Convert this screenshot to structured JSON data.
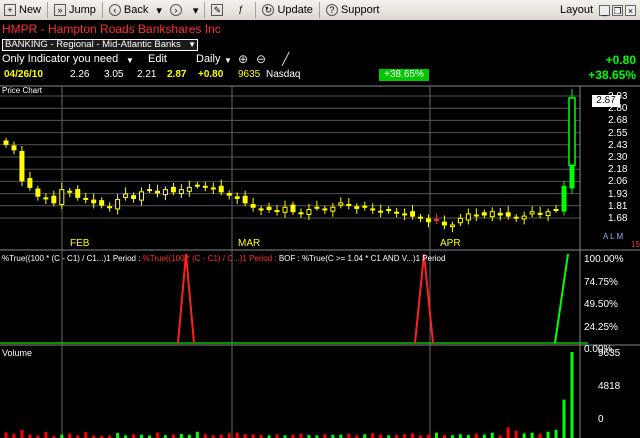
{
  "toolbar": {
    "new_label": "New",
    "jump_label": "Jump",
    "back_label": "Back",
    "update_label": "Update",
    "support_label": "Support",
    "layout_label": "Layout"
  },
  "header": {
    "symbol_title": "HMPR - Hampton Roads Bankshares Inc",
    "industry": "BANKING - Regional - Mid-Atlantic Banks",
    "watchlist": "Only Indicator you need",
    "edit_label": "Edit",
    "period": "Daily",
    "date": "04/26/10",
    "open": "2.26",
    "high": "3.05",
    "low": "2.21",
    "close": "2.87",
    "change": "+0.80",
    "volume": "9635",
    "exchange": "Nasdaq",
    "pct_change_box": "+38.65%",
    "right_change": "+0.80",
    "right_pct": "+38.65%"
  },
  "price_chart": {
    "label": "Price Chart",
    "current_price_label": "2.87",
    "axis_ticks": [
      "2.93",
      "2.80",
      "2.68",
      "2.55",
      "2.43",
      "2.30",
      "2.18",
      "2.06",
      "1.93",
      "1.81",
      "1.68"
    ],
    "months": [
      "FEB",
      "MAR",
      "APR"
    ],
    "scale_toggle": "A L M",
    "scale_extra": "15"
  },
  "indicator": {
    "label_part1": "%True((100 * (C - C1) / C1...)1 Period : ",
    "label_part2": "%True((100 * (C - C1) / C...)1 Period : ",
    "label_part3": "BOF : %True(C >= 1.04 * C1 AND V...)1 Period",
    "axis_ticks": [
      "100.00%",
      "74.75%",
      "49.50%",
      "24.25%",
      "0.00%"
    ]
  },
  "volume": {
    "label": "Volume",
    "axis_ticks": [
      "9635",
      "4818",
      "0"
    ]
  },
  "colors": {
    "background": "#000000",
    "candle": "#ffff00",
    "up": "#00ff00",
    "down": "#ff0000"
  },
  "chart_data": {
    "type": "candlestick",
    "symbol": "HMPR",
    "ylim": [
      1.62,
      2.96
    ],
    "close": [
      2.45,
      2.4,
      2.12,
      2.06,
      1.98,
      1.96,
      1.92,
      2.04,
      2.02,
      1.97,
      1.96,
      1.92,
      1.9,
      1.88,
      1.95,
      2.0,
      1.96,
      2.02,
      2.04,
      2.01,
      2.04,
      2.02,
      2.04,
      2.06,
      2.08,
      2.07,
      2.05,
      2.02,
      1.99,
      1.96,
      1.92,
      1.88,
      1.86,
      1.86,
      1.85,
      1.88,
      1.84,
      1.83,
      1.86,
      1.88,
      1.86,
      1.88,
      1.92,
      1.9,
      1.87,
      1.88,
      1.86,
      1.84,
      1.85,
      1.83,
      1.82,
      1.8,
      1.79,
      1.75,
      1.76,
      1.72,
      1.72,
      1.78,
      1.82,
      1.81,
      1.81,
      1.84,
      1.81,
      1.8,
      1.79,
      1.8,
      1.84,
      1.82,
      1.84,
      1.86,
      2.07,
      2.87
    ],
    "volume": [
      620,
      480,
      900,
      400,
      300,
      700,
      250,
      380,
      500,
      300,
      650,
      280,
      240,
      300,
      560,
      300,
      420,
      360,
      280,
      600,
      320,
      380,
      450,
      360,
      700,
      420,
      300,
      380,
      520,
      600,
      450,
      400,
      350,
      300,
      420,
      300,
      360,
      480,
      330,
      300,
      420,
      350,
      380,
      480,
      300,
      420,
      540,
      380,
      300,
      330,
      420,
      520,
      300,
      380,
      600,
      360,
      300,
      420,
      330,
      480,
      380,
      600,
      300,
      1200,
      800,
      520,
      600,
      480,
      700,
      900,
      4300,
      9635
    ]
  }
}
